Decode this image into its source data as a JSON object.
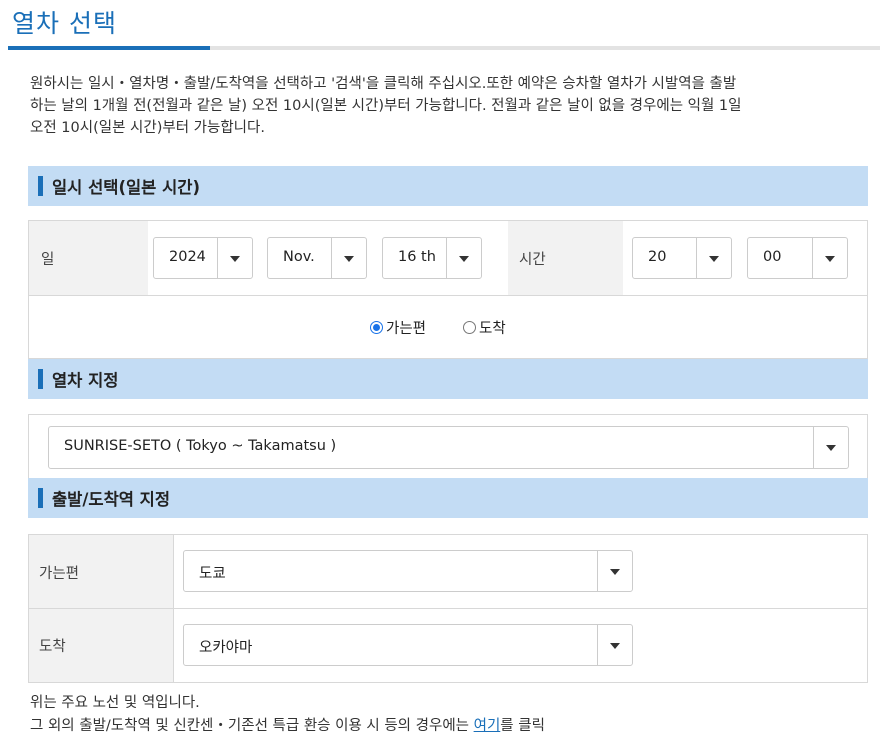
{
  "page": {
    "title": "열차 선택"
  },
  "intro": {
    "line1": "원하시는 일시・열차명・출발/도착역을 선택하고 '검색'을 클릭해 주십시오.또한 예약은 승차할 열차가 시발역을 출발",
    "line2": "하는 날의 1개월 전(전월과 같은 날) 오전 10시(일본 시간)부터 가능합니다. 전월과 같은 날이 없을 경우에는 익월 1일",
    "line3": "오전 10시(일본 시간)부터 가능합니다."
  },
  "datetime_section": {
    "heading": "일시 선택(일본 시간)",
    "day_label": "일",
    "year": "2024",
    "month": "Nov.",
    "day": "16 th",
    "time_label": "시간",
    "hour": "20",
    "minute": "00",
    "radio_departure": "가는편",
    "radio_arrival": "도착",
    "selected_mode": "departure"
  },
  "train_section": {
    "heading": "열차 지정",
    "selected_train": "SUNRISE-SETO ( Tokyo ~ Takamatsu )"
  },
  "station_section": {
    "heading": "출발/도착역 지정",
    "departure_label": "가는편",
    "departure_value": "도쿄",
    "arrival_label": "도착",
    "arrival_value": "오카야마"
  },
  "footer": {
    "note1": "위는 주요 노선 및 역입니다.",
    "note2_prefix": "그 외의 출발/도착역 및 신칸센・기존선 특급 환승 이용 시 등의 경우에는 ",
    "note2_link": "여기",
    "note2_suffix": "를 클릭"
  },
  "colors": {
    "accent": "#1a6fb8",
    "section_bg": "#c3dcf4",
    "label_bg": "#f2f2f2"
  }
}
